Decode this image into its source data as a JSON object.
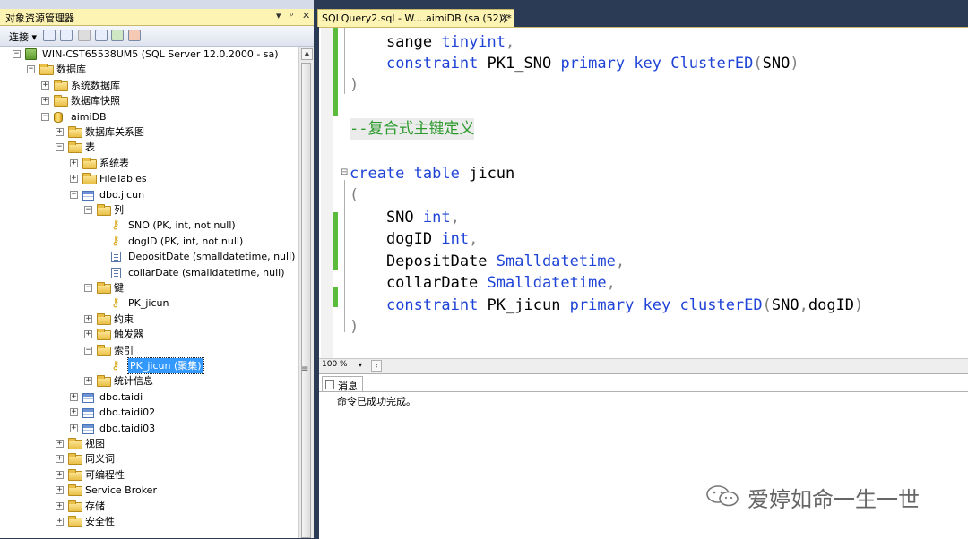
{
  "object_explorer": {
    "title": "对象资源管理器",
    "pin_glyphs": [
      "▾",
      "ᵖ",
      "✕"
    ],
    "toolbar": {
      "connect_label": "连接 ▾"
    },
    "tree": [
      {
        "label": "WIN-CST65538UM5 (SQL Server 12.0.2000 - sa)",
        "icon": "server-icon",
        "expander": "−"
      },
      {
        "label": "数据库",
        "icon": "folder-icon",
        "expander": "−"
      },
      {
        "label": "系统数据库",
        "icon": "folder-icon",
        "expander": "+"
      },
      {
        "label": "数据库快照",
        "icon": "folder-icon",
        "expander": "+"
      },
      {
        "label": "aimiDB",
        "icon": "database-icon",
        "expander": "−"
      },
      {
        "label": "数据库关系图",
        "icon": "folder-icon",
        "expander": "+"
      },
      {
        "label": "表",
        "icon": "folder-icon",
        "expander": "−"
      },
      {
        "label": "系统表",
        "icon": "folder-icon",
        "expander": "+"
      },
      {
        "label": "FileTables",
        "icon": "folder-icon",
        "expander": "+"
      },
      {
        "label": "dbo.jicun",
        "icon": "table-icon",
        "expander": "−"
      },
      {
        "label": "列",
        "icon": "folder-icon",
        "expander": "−"
      },
      {
        "label": "SNO (PK, int, not null)",
        "icon": "key-icon",
        "expander": ""
      },
      {
        "label": "dogID (PK, int, not null)",
        "icon": "key-icon",
        "expander": ""
      },
      {
        "label": "DepositDate (smalldatetime, null)",
        "icon": "column-icon",
        "expander": ""
      },
      {
        "label": "collarDate (smalldatetime, null)",
        "icon": "column-icon",
        "expander": ""
      },
      {
        "label": "键",
        "icon": "folder-icon",
        "expander": "−"
      },
      {
        "label": "PK_jicun",
        "icon": "key-icon",
        "expander": ""
      },
      {
        "label": "约束",
        "icon": "folder-icon",
        "expander": "+"
      },
      {
        "label": "触发器",
        "icon": "folder-icon",
        "expander": "+"
      },
      {
        "label": "索引",
        "icon": "folder-icon",
        "expander": "−"
      },
      {
        "label": "PK_jicun (聚集)",
        "icon": "key-icon",
        "expander": "",
        "selected": true
      },
      {
        "label": "统计信息",
        "icon": "folder-icon",
        "expander": "+"
      },
      {
        "label": "dbo.taidi",
        "icon": "table-icon",
        "expander": "+"
      },
      {
        "label": "dbo.taidi02",
        "icon": "table-icon",
        "expander": "+"
      },
      {
        "label": "dbo.taidi03",
        "icon": "table-icon",
        "expander": "+"
      },
      {
        "label": "视图",
        "icon": "folder-icon",
        "expander": "+"
      },
      {
        "label": "同义词",
        "icon": "folder-icon",
        "expander": "+"
      },
      {
        "label": "可编程性",
        "icon": "folder-icon",
        "expander": "+"
      },
      {
        "label": "Service Broker",
        "icon": "folder-icon",
        "expander": "+"
      },
      {
        "label": "存储",
        "icon": "folder-icon",
        "expander": "+"
      },
      {
        "label": "安全性",
        "icon": "folder-icon",
        "expander": "+"
      }
    ]
  },
  "editor": {
    "tab_title": "SQLQuery2.sql - W....aimiDB (sa (52))*",
    "tab_close": "✕",
    "lines": [
      [
        {
          "t": "    sange ",
          "c": ""
        },
        {
          "t": "tinyint",
          "c": "kw"
        },
        {
          "t": ",",
          "c": "gy"
        }
      ],
      [
        {
          "t": "    ",
          "c": ""
        },
        {
          "t": "constraint",
          "c": "kw"
        },
        {
          "t": " PK1_SNO ",
          "c": ""
        },
        {
          "t": "primary key",
          "c": "kw"
        },
        {
          "t": " ",
          "c": ""
        },
        {
          "t": "ClusterED",
          "c": "kw"
        },
        {
          "t": "(",
          "c": "gy"
        },
        {
          "t": "SNO",
          "c": ""
        },
        {
          "t": ")",
          "c": "gy"
        }
      ],
      [
        {
          "t": ")",
          "c": "gy"
        }
      ],
      [
        {
          "t": "",
          "c": ""
        }
      ],
      [
        {
          "t": "--复合式主键定义",
          "c": "cm"
        }
      ],
      [
        {
          "t": "",
          "c": ""
        }
      ],
      [
        {
          "t": "create",
          "c": "kw"
        },
        {
          "t": " ",
          "c": ""
        },
        {
          "t": "table",
          "c": "kw"
        },
        {
          "t": " jicun",
          "c": ""
        }
      ],
      [
        {
          "t": "(",
          "c": "gy"
        }
      ],
      [
        {
          "t": "    SNO ",
          "c": ""
        },
        {
          "t": "int",
          "c": "kw"
        },
        {
          "t": ",",
          "c": "gy"
        }
      ],
      [
        {
          "t": "    dogID ",
          "c": ""
        },
        {
          "t": "int",
          "c": "kw"
        },
        {
          "t": ",",
          "c": "gy"
        }
      ],
      [
        {
          "t": "    DepositDate ",
          "c": ""
        },
        {
          "t": "Smalldatetime",
          "c": "kw"
        },
        {
          "t": ",",
          "c": "gy"
        }
      ],
      [
        {
          "t": "    collarDate ",
          "c": ""
        },
        {
          "t": "Smalldatetime",
          "c": "kw"
        },
        {
          "t": ",",
          "c": "gy"
        }
      ],
      [
        {
          "t": "    ",
          "c": ""
        },
        {
          "t": "constraint",
          "c": "kw"
        },
        {
          "t": " PK_jicun ",
          "c": ""
        },
        {
          "t": "primary key",
          "c": "kw"
        },
        {
          "t": " ",
          "c": ""
        },
        {
          "t": "clusterED",
          "c": "kw"
        },
        {
          "t": "(",
          "c": "gy"
        },
        {
          "t": "SNO",
          "c": ""
        },
        {
          "t": ",",
          "c": "gy"
        },
        {
          "t": "dogID",
          "c": ""
        },
        {
          "t": ")",
          "c": "gy"
        }
      ],
      [
        {
          "t": ")",
          "c": "gy"
        }
      ]
    ]
  },
  "zoom": {
    "value": "100 %",
    "dropdown": "▾",
    "scroll_left": "‹"
  },
  "results": {
    "tab_label": "消息",
    "message": "命令已成功完成。"
  },
  "watermark": "爱婷如命一生一世",
  "colors": {
    "keyword": "#1e43d6",
    "comment": "#2c9a2c",
    "selection": "#3399ff",
    "title_bar": "#fdf3b3"
  }
}
